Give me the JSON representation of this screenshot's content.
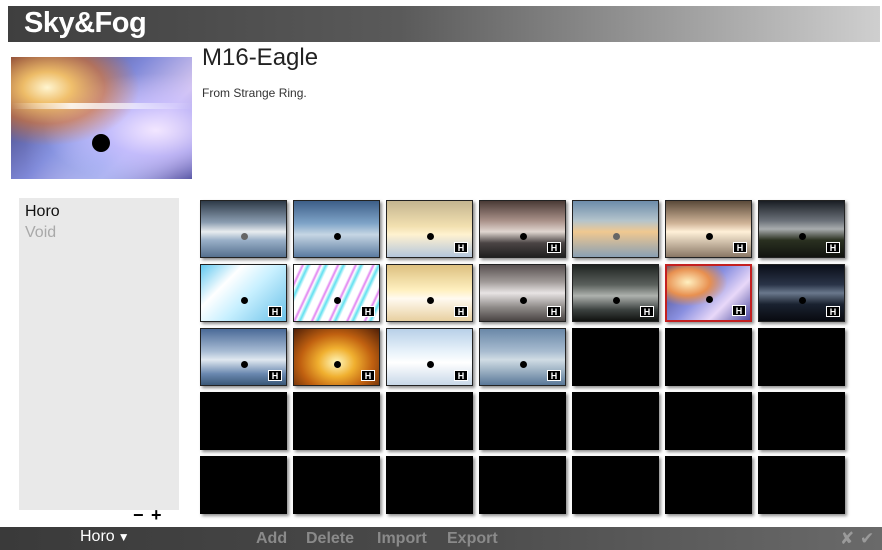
{
  "app": {
    "title": "Sky&Fog"
  },
  "detail": {
    "name": "M16-Eagle",
    "description": "From Strange Ring."
  },
  "categories": [
    {
      "label": "Horo",
      "selected": true
    },
    {
      "label": "Void",
      "selected": false
    }
  ],
  "list_controls": {
    "remove": "−",
    "add": "+"
  },
  "grid": {
    "badge_label": "H",
    "tiles": [
      {
        "bg": "linear-gradient(to bottom,#2e3a48 0%,#8a9cb0 38%,#e8ecef 55%,#9ab0c8 70%,#56708e 100%)",
        "dot": "grey",
        "badge": false
      },
      {
        "bg": "linear-gradient(to bottom,#3d5e88 0%,#7fa4c8 40%,#c6d6e4 60%,#5b7ba0 100%)",
        "dot": "black",
        "badge": false
      },
      {
        "bg": "linear-gradient(to bottom,#c4b590 0%,#f2e0b0 45%,#fff2d0 60%,#b4c6dc 100%)",
        "dot": "black",
        "badge": true
      },
      {
        "bg": "linear-gradient(to bottom,#4a3a36 0%,#a89088 35%,#e0d6d0 55%,#4a4444 75%,#202020 100%)",
        "dot": "black",
        "badge": true
      },
      {
        "bg": "linear-gradient(to bottom,#6c8caa 0%,#b4c4cc 35%,#f0c890 55%,#8aa0b4 100%)",
        "dot": "grey",
        "badge": false
      },
      {
        "bg": "linear-gradient(to bottom,#5a4a3a 0%,#d0b498 40%,#fff0d8 55%,#8a7866 100%)",
        "dot": "black",
        "badge": true
      },
      {
        "bg": "linear-gradient(to bottom,#1a1e24 0%,#6a7078 35%,#a8acae 50%,#2a3020 70%,#121410 100%)",
        "dot": "black",
        "badge": true
      },
      {
        "bg": "linear-gradient(135deg,#60c8f0 0%,#ffffff 30%,#c8f0ff 55%,#6ac0e8 100%)",
        "dot": "black",
        "badge": true
      },
      {
        "bg": "repeating-linear-gradient(115deg,#ffffff 0px,#ffffff 6px,#e080f0 8px,#ffffff 10px,#60e0f0 13px,#ffffff 16px)",
        "dot": "black",
        "badge": true
      },
      {
        "bg": "linear-gradient(to bottom,#dcc080 0%,#fff0c0 45%,#fffaf0 60%,#e8d0a0 100%)",
        "dot": "black",
        "badge": true
      },
      {
        "bg": "linear-gradient(to bottom,#585050 0%,#a09a98 30%,#e8e4e4 50%,#908c8a 75%,#4a4444 100%)",
        "dot": "black",
        "badge": true
      },
      {
        "bg": "linear-gradient(to bottom,#202422 0%,#5a605c 35%,#aeb2ae 55%,#3c4240 80%,#101210 100%)",
        "dot": "black",
        "badge": true
      },
      {
        "bg": "radial-gradient(ellipse at 25% 30%,#fff0c0 0%,#e89050 25%,transparent 45%),linear-gradient(135deg,#3a3a7a 0%,#8a90e0 45%,#e8d8f8 70%,#4a4aa0 100%)",
        "dot": "black",
        "badge": true,
        "selected": true
      },
      {
        "bg": "linear-gradient(to bottom,#0a0e18 0%,#2a3448 35%,#6a788c 50%,#1a2230 70%,#080a10 100%)",
        "dot": "black",
        "badge": true
      },
      {
        "bg": "linear-gradient(to bottom,#4a6a98 0%,#a8bcd4 40%,#e0e8f0 55%,#6a88b0 80%,#3a5878 100%)",
        "dot": "black",
        "badge": true
      },
      {
        "bg": "radial-gradient(ellipse at 50% 60%,#fff8c0 0%,#f0b030 30%,#c06010 60%,#502008 100%)",
        "dot": "black",
        "badge": true
      },
      {
        "bg": "linear-gradient(to bottom,#b8d0e8 0%,#e8f2fa 40%,#ffffff 60%,#c8d8e8 100%)",
        "dot": "black",
        "badge": true
      },
      {
        "bg": "linear-gradient(to bottom,#6a88a8 0%,#a8bcd0 40%,#d0dce4 55%,#5a7898 100%)",
        "dot": "black",
        "badge": true
      },
      {
        "bg": "#000000",
        "dot": "none",
        "badge": false
      },
      {
        "bg": "#000000",
        "dot": "none",
        "badge": false
      },
      {
        "bg": "#000000",
        "dot": "none",
        "badge": false
      },
      {
        "bg": "#000000",
        "dot": "none",
        "badge": false
      },
      {
        "bg": "#000000",
        "dot": "none",
        "badge": false
      },
      {
        "bg": "#000000",
        "dot": "none",
        "badge": false
      },
      {
        "bg": "#000000",
        "dot": "none",
        "badge": false
      },
      {
        "bg": "#000000",
        "dot": "none",
        "badge": false
      },
      {
        "bg": "#000000",
        "dot": "none",
        "badge": false
      },
      {
        "bg": "#000000",
        "dot": "none",
        "badge": false
      },
      {
        "bg": "#000000",
        "dot": "none",
        "badge": false
      },
      {
        "bg": "#000000",
        "dot": "none",
        "badge": false
      },
      {
        "bg": "#000000",
        "dot": "none",
        "badge": false
      },
      {
        "bg": "#000000",
        "dot": "none",
        "badge": false
      },
      {
        "bg": "#000000",
        "dot": "none",
        "badge": false
      },
      {
        "bg": "#000000",
        "dot": "none",
        "badge": false
      },
      {
        "bg": "#000000",
        "dot": "none",
        "badge": false
      }
    ]
  },
  "bottombar": {
    "dropdown_label": "Horo",
    "dropdown_icon": "chevron-down-icon",
    "buttons": {
      "add": "Add",
      "delete": "Delete",
      "import": "Import",
      "export": "Export"
    },
    "cancel_icon": "close-icon",
    "confirm_icon": "check-icon"
  }
}
